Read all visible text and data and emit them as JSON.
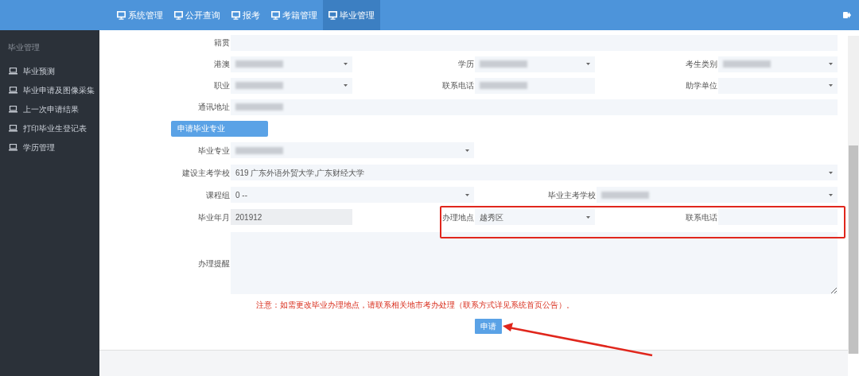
{
  "nav": {
    "items": [
      {
        "label": "系统管理",
        "selected": false
      },
      {
        "label": "公开查询",
        "selected": false
      },
      {
        "label": "报考",
        "selected": false
      },
      {
        "label": "考籍管理",
        "selected": false
      },
      {
        "label": "毕业管理",
        "selected": true
      }
    ]
  },
  "sidebar": {
    "title": "毕业管理",
    "items": [
      {
        "label": "毕业预测"
      },
      {
        "label": "毕业申请及图像采集"
      },
      {
        "label": "上一次申请结果"
      },
      {
        "label": "打印毕业生登记表"
      },
      {
        "label": "学历管理"
      }
    ]
  },
  "form": {
    "rows_top": [
      [
        {
          "label": "籍贯",
          "kind": "input",
          "blurred": false
        }
      ],
      [
        {
          "label": "港澳",
          "kind": "select",
          "blurred": true
        },
        {
          "label": "学历",
          "kind": "select",
          "blurred": true
        },
        {
          "label": "考生类别",
          "kind": "select",
          "blurred": true
        }
      ],
      [
        {
          "label": "职业",
          "kind": "select",
          "blurred": true
        },
        {
          "label": "联系电话",
          "kind": "input",
          "blurred": true
        },
        {
          "label": "助学单位",
          "kind": "select",
          "blurred": false
        }
      ],
      [
        {
          "label": "通讯地址",
          "kind": "input",
          "blurred": true
        }
      ]
    ],
    "section_button": "申请毕业专业",
    "rows_bottom": [
      [
        {
          "label": "毕业专业",
          "kind": "select",
          "blurred": true
        }
      ],
      [
        {
          "label": "建设主考学校",
          "kind": "select",
          "blurred": false,
          "value": "619 广东外语外贸大学,广东财经大学"
        }
      ],
      [
        {
          "label": "课程组",
          "kind": "select",
          "blurred": false,
          "value": "0 --"
        },
        {
          "label": "毕业主考学校",
          "kind": "select",
          "blurred": true
        }
      ],
      [
        {
          "label": "毕业年月",
          "kind": "readonly",
          "blurred": false,
          "value": "201912"
        },
        {
          "label": "办理地点",
          "kind": "select",
          "blurred": false,
          "value": "越秀区"
        },
        {
          "label": "联系电话",
          "kind": "input",
          "blurred": false
        }
      ]
    ],
    "remark": {
      "label": "办理提醒"
    },
    "notice": "注意：如需更改毕业办理地点，请联系相关地市考办处理（联系方式详见系统首页公告）。",
    "submit": "申请"
  }
}
